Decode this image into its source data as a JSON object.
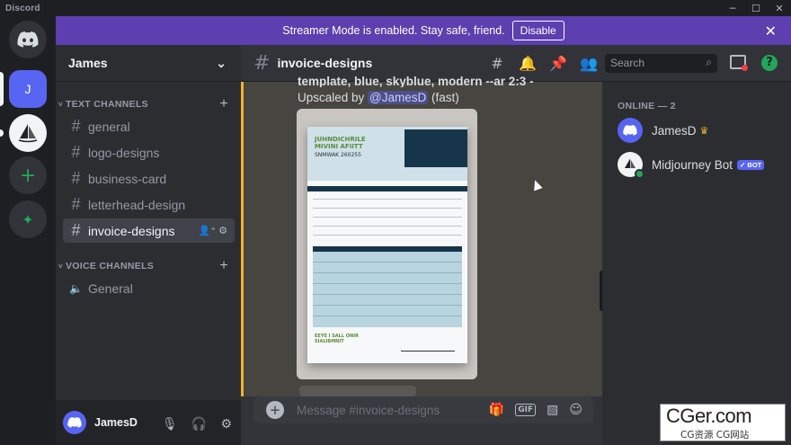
{
  "app": {
    "title": "Discord"
  },
  "window_controls": {
    "minimize": "─",
    "maximize": "☐",
    "close": "✕"
  },
  "banner": {
    "text": "Streamer Mode is enabled. Stay safe, friend.",
    "button": "Disable",
    "close": "✕"
  },
  "guilds": {
    "add": "+",
    "explore": "✦"
  },
  "server": {
    "name": "James",
    "menu": "⌄"
  },
  "categories": {
    "text": "TEXT CHANNELS",
    "voice": "VOICE CHANNELS"
  },
  "text_channels": [
    {
      "label": "general"
    },
    {
      "label": "logo-designs"
    },
    {
      "label": "business-card"
    },
    {
      "label": "letterhead-design"
    },
    {
      "label": "invoice-designs",
      "selected": true
    }
  ],
  "voice_channels": [
    {
      "label": "General"
    }
  ],
  "channel_glyphs": {
    "text": "#",
    "voice": "🔈",
    "add": "+",
    "collapse": "⌄"
  },
  "user": {
    "name": "JamesD",
    "icons": [
      "mic-icon",
      "headphones-icon",
      "settings-icon"
    ]
  },
  "chat_header": {
    "channel": "invoice-designs"
  },
  "search": {
    "placeholder": "Search"
  },
  "message": {
    "line1": "template, blue, skyblue, modern --ar 2:3 -",
    "line2_prefix": "Upscaled by ",
    "mention": "@JamesD",
    "line2_suffix": " (fast)"
  },
  "invoice_image": {
    "title": "JUHNDICHRILE MIVINI AFIITT",
    "number": "SNMWAK 260255",
    "footer_left": "EEYE I SALL ONIR SIALIBMNIT"
  },
  "composer": {
    "plus": "+",
    "placeholder": "Message #invoice-designs",
    "gif": "GIF"
  },
  "members": {
    "heading": "ONLINE — 2",
    "list": [
      {
        "name": "JamesD",
        "badge": "♛"
      },
      {
        "name": "Midjourney Bot",
        "tag": "✓ BOT"
      }
    ]
  },
  "watermark": {
    "brand": "CGer.com",
    "sub": "CG资源 CG网站"
  },
  "colors": {
    "accent": "#5865f2",
    "banner": "#5d3fb0",
    "online": "#23a55a",
    "mention_bar": "#f0b232"
  }
}
